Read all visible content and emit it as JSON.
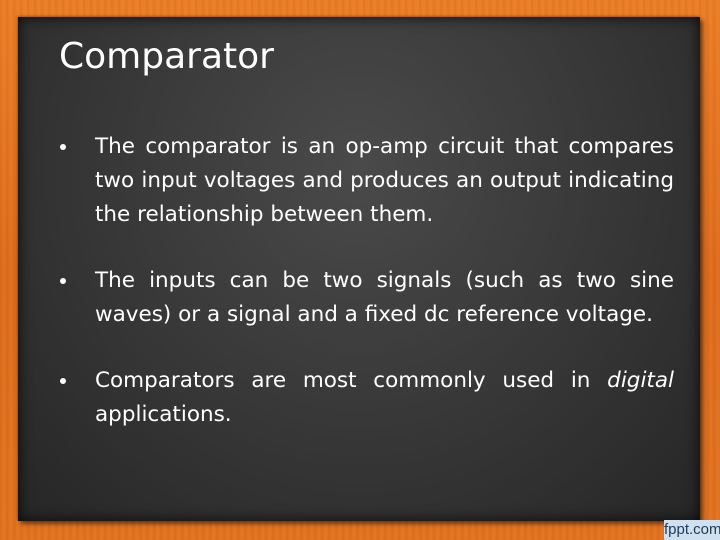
{
  "slide": {
    "title": "Comparator",
    "bullets": [
      {
        "text": "The comparator is an op-amp circuit that compares two input voltages and produces an output indicating the relationship between them."
      },
      {
        "text": "The inputs can be two signals (such as two sine waves) or a signal and a fixed dc reference voltage."
      },
      {
        "text_before": "Comparators are most commonly used in ",
        "emphasis": "digital",
        "text_after": " applications."
      }
    ]
  },
  "watermark": "fppt.com",
  "colors": {
    "frame": "#e2701f",
    "board": "#3a3a3a",
    "text": "#ffffff"
  }
}
